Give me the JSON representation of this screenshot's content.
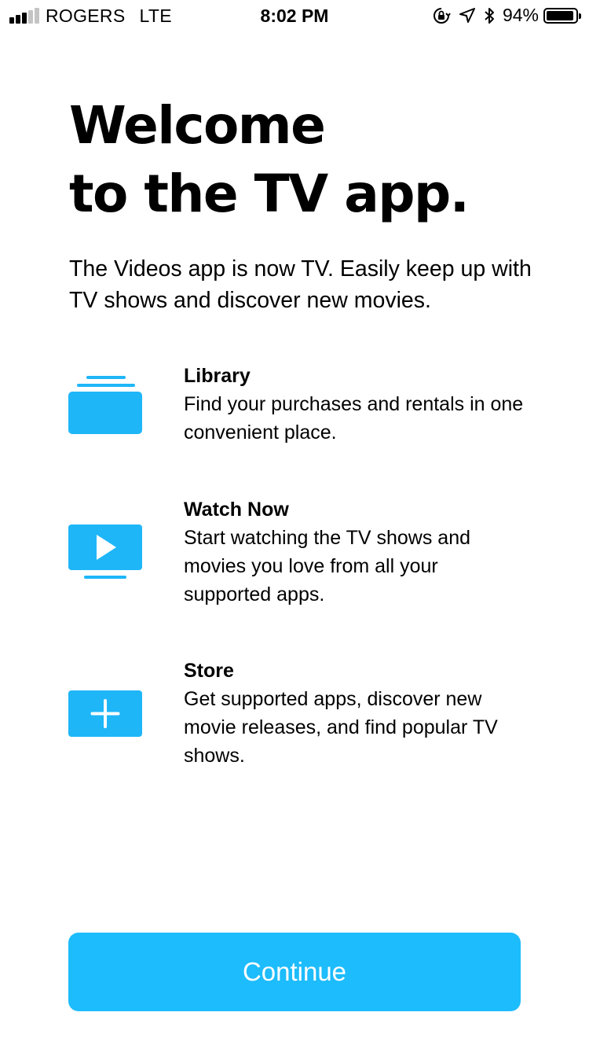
{
  "status_bar": {
    "carrier": "ROGERS",
    "network": "LTE",
    "time": "8:02 PM",
    "battery_percent": "94%",
    "battery_level": 0.94,
    "signal_bars_active": 3,
    "signal_bars_total": 5,
    "icons": [
      "orientation-lock-icon",
      "location-arrow-icon",
      "bluetooth-icon",
      "battery-icon"
    ]
  },
  "welcome": {
    "title_line1": "Welcome",
    "title_line2": "to the TV app.",
    "intro": "The Videos app is now TV. Easily keep up with TV shows and discover new movies."
  },
  "features": [
    {
      "icon": "library-stack-icon",
      "title": "Library",
      "description": "Find your purchases and rentals in one convenient place."
    },
    {
      "icon": "watch-now-play-icon",
      "title": "Watch Now",
      "description": "Start watching the TV shows and movies you love from all your supported apps."
    },
    {
      "icon": "store-plus-icon",
      "title": "Store",
      "description": "Get supported apps, discover new movie releases, and find popular TV shows."
    }
  ],
  "continue_label": "Continue",
  "colors": {
    "accent": "#1dbcfc",
    "icon_blue": "#1fb6f8",
    "text": "#000000",
    "background": "#ffffff"
  }
}
